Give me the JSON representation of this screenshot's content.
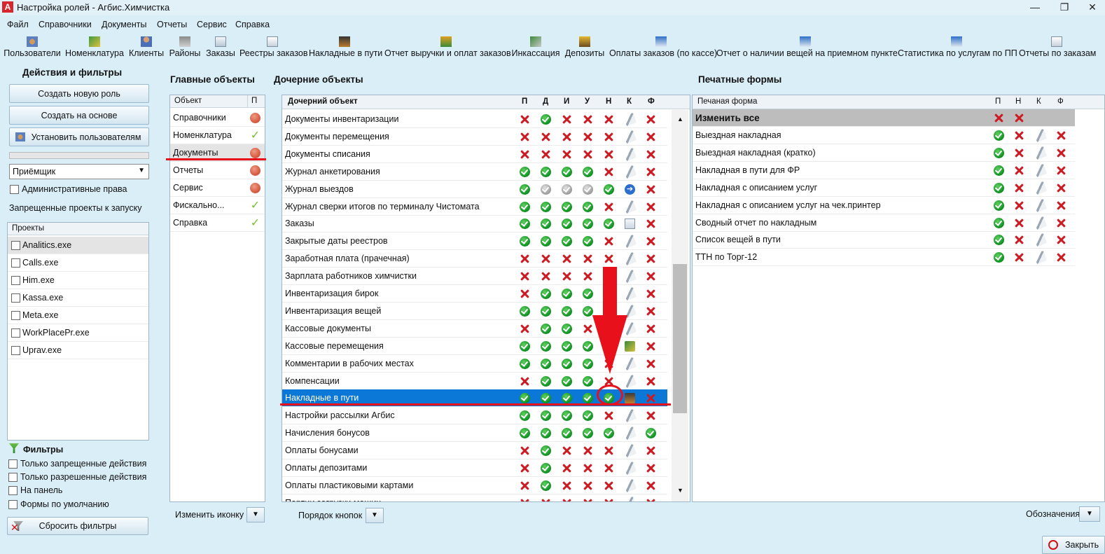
{
  "window": {
    "title": "Настройка ролей - Агбис.Химчистка",
    "logo": "A"
  },
  "menu": [
    "Файл",
    "Справочники",
    "Документы",
    "Отчеты",
    "Сервис",
    "Справка"
  ],
  "toolbar": [
    {
      "label": "Пользователи",
      "icon": "users-icon"
    },
    {
      "label": "Номенклатура",
      "icon": "nomenclature-icon"
    },
    {
      "label": "Клиенты",
      "icon": "client-icon"
    },
    {
      "label": "Районы",
      "icon": "district-icon"
    },
    {
      "label": "Заказы",
      "icon": "orders-icon"
    },
    {
      "label": "Реестры заказов",
      "icon": "registry-icon"
    },
    {
      "label": "Накладные в пути",
      "icon": "truck-icon"
    },
    {
      "label": "Отчет выручки и оплат заказов",
      "icon": "revenue-report-icon"
    },
    {
      "label": "Инкассация",
      "icon": "cash-collection-icon"
    },
    {
      "label": "Депозиты",
      "icon": "deposit-icon"
    },
    {
      "label": "Оплаты заказов (по кассе)",
      "icon": "payments-icon"
    },
    {
      "label": "Отчет о наличии вещей на приемном пункте",
      "icon": "items-report-icon"
    },
    {
      "label": "Статистика по услугам по ПП",
      "icon": "statistics-icon"
    },
    {
      "label": "Отчеты по заказам",
      "icon": "order-reports-icon"
    }
  ],
  "left": {
    "title": "Действия и фильтры",
    "create_role": "Создать новую роль",
    "create_based": "Создать на основе",
    "assign_users": "Установить пользователям",
    "role_select": "Приёмщик",
    "admin_rights": "Административные права",
    "forbidden_label": "Запрещенные проекты к запуску",
    "projects_header": "Проекты",
    "projects": [
      "Analitics.exe",
      "Calls.exe",
      "Him.exe",
      "Kassa.exe",
      "Meta.exe",
      "WorkPlacePr.exe",
      "Uprav.exe"
    ],
    "filters_title": "Фильтры",
    "filters": [
      "Только запрещенные действия",
      "Только разрешенные действия",
      "На панель",
      "Формы по умолчанию"
    ],
    "reset_filters": "Сбросить фильтры"
  },
  "main_objects": {
    "title": "Главные объекты",
    "col_object": "Объект",
    "col_p": "П",
    "rows": [
      {
        "name": "Справочники",
        "status": "red-ring"
      },
      {
        "name": "Номенклатура",
        "status": "tick"
      },
      {
        "name": "Документы",
        "status": "red-ring"
      },
      {
        "name": "Отчеты",
        "status": "red-ring"
      },
      {
        "name": "Сервис",
        "status": "red-ring"
      },
      {
        "name": "Фискально...",
        "status": "tick"
      },
      {
        "name": "Справка",
        "status": "tick"
      }
    ],
    "change_icon": "Изменить иконку"
  },
  "child_objects": {
    "title": "Дочерние объекты",
    "col_name": "Дочерний объект",
    "cols": [
      "П",
      "Д",
      "И",
      "У",
      "Н",
      "К",
      "Ф"
    ],
    "selected_row": 16,
    "rows": [
      {
        "name": "Документы инвентаризации",
        "v": [
          "no",
          "ok",
          "no",
          "no",
          "no",
          "disk",
          "no"
        ]
      },
      {
        "name": "Документы перемещения",
        "v": [
          "no",
          "no",
          "no",
          "no",
          "no",
          "disk",
          "no"
        ]
      },
      {
        "name": "Документы списания",
        "v": [
          "no",
          "no",
          "no",
          "no",
          "no",
          "disk",
          "no"
        ]
      },
      {
        "name": "Журнал анкетирования",
        "v": [
          "ok",
          "ok",
          "ok",
          "ok",
          "no",
          "disk",
          "no"
        ]
      },
      {
        "name": "Журнал выездов",
        "v": [
          "ok",
          "grey",
          "grey",
          "grey",
          "ok",
          "arrow",
          "no"
        ]
      },
      {
        "name": "Журнал сверки итогов по терминалу Чистомата",
        "v": [
          "ok",
          "ok",
          "ok",
          "ok",
          "no",
          "disk",
          "no"
        ]
      },
      {
        "name": "Заказы",
        "v": [
          "ok",
          "ok",
          "ok",
          "ok",
          "ok",
          "doc",
          "no"
        ]
      },
      {
        "name": "Закрытые даты реестров",
        "v": [
          "ok",
          "ok",
          "ok",
          "ok",
          "no",
          "disk",
          "no"
        ]
      },
      {
        "name": "Заработная плата (прачечная)",
        "v": [
          "no",
          "no",
          "no",
          "no",
          "no",
          "disk",
          "no"
        ]
      },
      {
        "name": "Зарплата работников химчистки",
        "v": [
          "no",
          "no",
          "no",
          "no",
          "no",
          "disk",
          "no"
        ]
      },
      {
        "name": "Инвентаризация бирок",
        "v": [
          "no",
          "ok",
          "ok",
          "ok",
          "no",
          "disk",
          "no"
        ]
      },
      {
        "name": "Инвентаризация вещей",
        "v": [
          "ok",
          "ok",
          "ok",
          "ok",
          "no",
          "disk",
          "no"
        ]
      },
      {
        "name": "Кассовые документы",
        "v": [
          "no",
          "ok",
          "ok",
          "no",
          "no",
          "disk",
          "no"
        ]
      },
      {
        "name": "Кассовые перемещения",
        "v": [
          "ok",
          "ok",
          "ok",
          "ok",
          "no",
          "money",
          "no"
        ]
      },
      {
        "name": "Комментарии в рабочих местах",
        "v": [
          "ok",
          "ok",
          "ok",
          "ok",
          "no",
          "disk",
          "no"
        ]
      },
      {
        "name": "Компенсации",
        "v": [
          "no",
          "ok",
          "ok",
          "ok",
          "no",
          "disk",
          "no"
        ]
      },
      {
        "name": "Накладные в пути",
        "v": [
          "ok",
          "ok",
          "ok",
          "ok",
          "ok",
          "truck",
          "no"
        ]
      },
      {
        "name": "Настройки рассылки Агбис",
        "v": [
          "ok",
          "ok",
          "ok",
          "ok",
          "no",
          "disk",
          "no"
        ]
      },
      {
        "name": "Начисления бонусов",
        "v": [
          "ok",
          "ok",
          "ok",
          "ok",
          "ok",
          "disk",
          "ok"
        ]
      },
      {
        "name": "Оплаты бонусами",
        "v": [
          "no",
          "ok",
          "no",
          "no",
          "no",
          "disk",
          "no"
        ]
      },
      {
        "name": "Оплаты депозитами",
        "v": [
          "no",
          "ok",
          "no",
          "no",
          "no",
          "disk",
          "no"
        ]
      },
      {
        "name": "Оплаты пластиковыми картами",
        "v": [
          "no",
          "ok",
          "no",
          "no",
          "no",
          "disk",
          "no"
        ]
      },
      {
        "name": "Партии загрузки машин",
        "v": [
          "no",
          "no",
          "no",
          "no",
          "no",
          "disk",
          "no"
        ]
      }
    ],
    "button_order": "Порядок кнопок"
  },
  "print_forms": {
    "title": "Печатные формы",
    "col_name": "Печаная форма",
    "cols": [
      "П",
      "Н",
      "К",
      "Ф"
    ],
    "change_all": "Изменить все",
    "rows": [
      {
        "name": "Выездная накладная",
        "v": [
          "ok",
          "no",
          "disk",
          "no"
        ]
      },
      {
        "name": "Выездная накладная (кратко)",
        "v": [
          "ok",
          "no",
          "disk",
          "no"
        ]
      },
      {
        "name": "Накладная в пути для ФР",
        "v": [
          "ok",
          "no",
          "disk",
          "no"
        ]
      },
      {
        "name": "Накладная с описанием услуг",
        "v": [
          "ok",
          "no",
          "disk",
          "no"
        ]
      },
      {
        "name": "Накладная с описанием услуг на чек.принтер",
        "v": [
          "ok",
          "no",
          "disk",
          "no"
        ]
      },
      {
        "name": "Сводный отчет по накладным",
        "v": [
          "ok",
          "no",
          "disk",
          "no"
        ]
      },
      {
        "name": "Список вещей в пути",
        "v": [
          "ok",
          "no",
          "disk",
          "no"
        ]
      },
      {
        "name": "ТТН по Торг-12",
        "v": [
          "ok",
          "no",
          "disk",
          "no"
        ]
      }
    ],
    "legend_label": "Обозначения"
  },
  "footer": {
    "close_label": "Закрыть"
  },
  "colors": {
    "accent_red": "#e8101a",
    "selection": "#0b78d7"
  }
}
